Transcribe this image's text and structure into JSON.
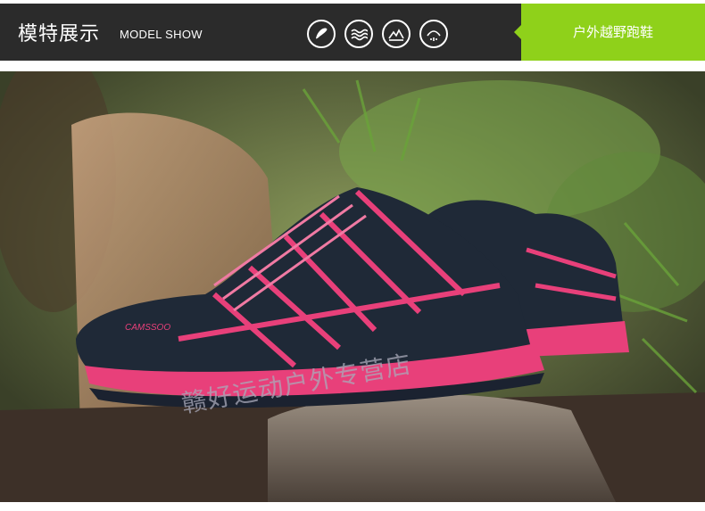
{
  "header": {
    "title_cn": "模特展示",
    "title_en": "MODEL SHOW",
    "feature_icons": [
      "foot-sole-icon",
      "waves-icon",
      "mountain-terrain-icon",
      "rain-drop-icon"
    ],
    "category_label": "户外越野跑鞋"
  },
  "photo": {
    "watermark": "赣好运动户外专营店",
    "shoe_brand_text": "CAMSSOO"
  },
  "colors": {
    "header_bg": "#2b2b2b",
    "accent_green": "#8fd11a",
    "shoe_pink": "#e8407a",
    "shoe_navy": "#1f2937"
  }
}
